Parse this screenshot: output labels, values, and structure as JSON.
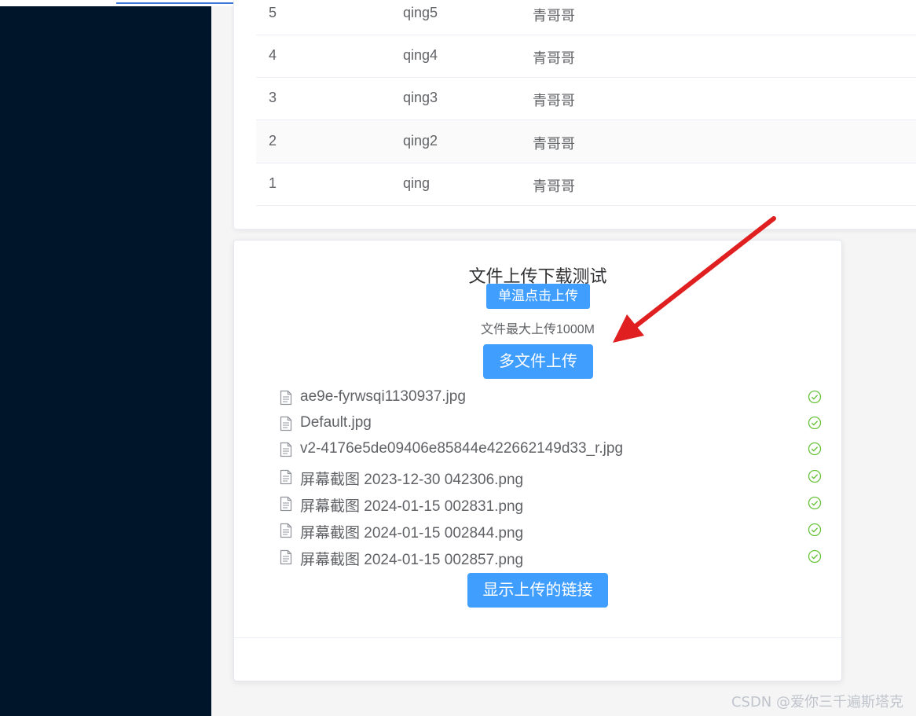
{
  "table": {
    "rows": [
      {
        "id": "5",
        "username": "qing5",
        "name": "青哥哥"
      },
      {
        "id": "4",
        "username": "qing4",
        "name": "青哥哥"
      },
      {
        "id": "3",
        "username": "qing3",
        "name": "青哥哥"
      },
      {
        "id": "2",
        "username": "qing2",
        "name": "青哥哥"
      },
      {
        "id": "1",
        "username": "qing",
        "name": "青哥哥"
      }
    ]
  },
  "upload": {
    "title": "文件上传下载测试",
    "single_button": "单温点击上传",
    "tip": "文件最大上传1000M",
    "multi_button": "多文件上传",
    "files": [
      {
        "name": "ae9e-fyrwsqi1130937.jpg",
        "status": "success"
      },
      {
        "name": "Default.jpg",
        "status": "success"
      },
      {
        "name": "v2-4176e5de09406e85844e422662149d33_r.jpg",
        "status": "success"
      },
      {
        "name": "屏幕截图 2023-12-30 042306.png",
        "status": "success"
      },
      {
        "name": "屏幕截图 2024-01-15 002831.png",
        "status": "success"
      },
      {
        "name": "屏幕截图 2024-01-15 002844.png",
        "status": "success"
      },
      {
        "name": "屏幕截图 2024-01-15 002857.png",
        "status": "success"
      }
    ],
    "links_button": "显示上传的链接"
  },
  "icons": {
    "file": "document-icon",
    "status": "check-circle-icon",
    "annotation": "red-arrow"
  },
  "colors": {
    "sidebar": "#001529",
    "primary": "#409eff",
    "success": "#67c23a",
    "arrow": "#e02020"
  },
  "watermark": "CSDN @爱你三千遍斯塔克"
}
